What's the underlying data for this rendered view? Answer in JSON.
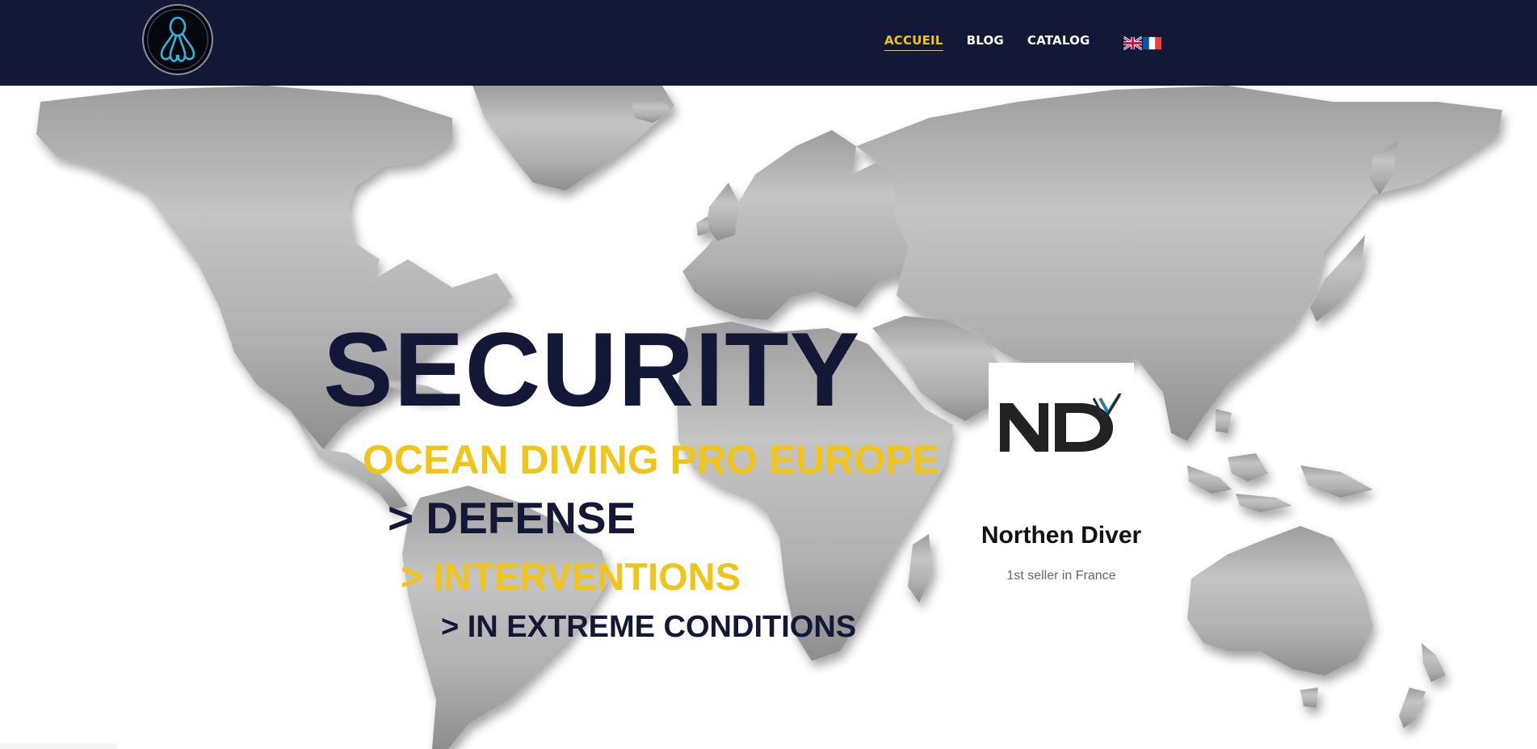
{
  "colors": {
    "header_bg": "#141837",
    "accent": "#f0c419",
    "navy": "#141837",
    "map_gray": "#b3b3b3"
  },
  "header": {
    "logo_icon": "octopus-logo-icon",
    "nav": [
      {
        "label": "ACCUEIL",
        "active": true
      },
      {
        "label": "BLOG",
        "active": false
      },
      {
        "label": "CATALOG",
        "active": false
      }
    ],
    "languages": [
      {
        "icon": "uk-flag-icon"
      },
      {
        "icon": "fr-flag-icon"
      }
    ]
  },
  "hero": {
    "background_icon": "world-map-icon",
    "headline": "SECURITY",
    "company": "OCEAN DIVING PRO EUROPE",
    "lines": [
      "> DEFENSE",
      "> INTERVENTIONS",
      "> IN EXTREME CONDITIONS"
    ]
  },
  "brand": {
    "logo_icon": "ndiver-logo-icon",
    "name": "Northen Diver",
    "tagline": "1st seller in France"
  }
}
